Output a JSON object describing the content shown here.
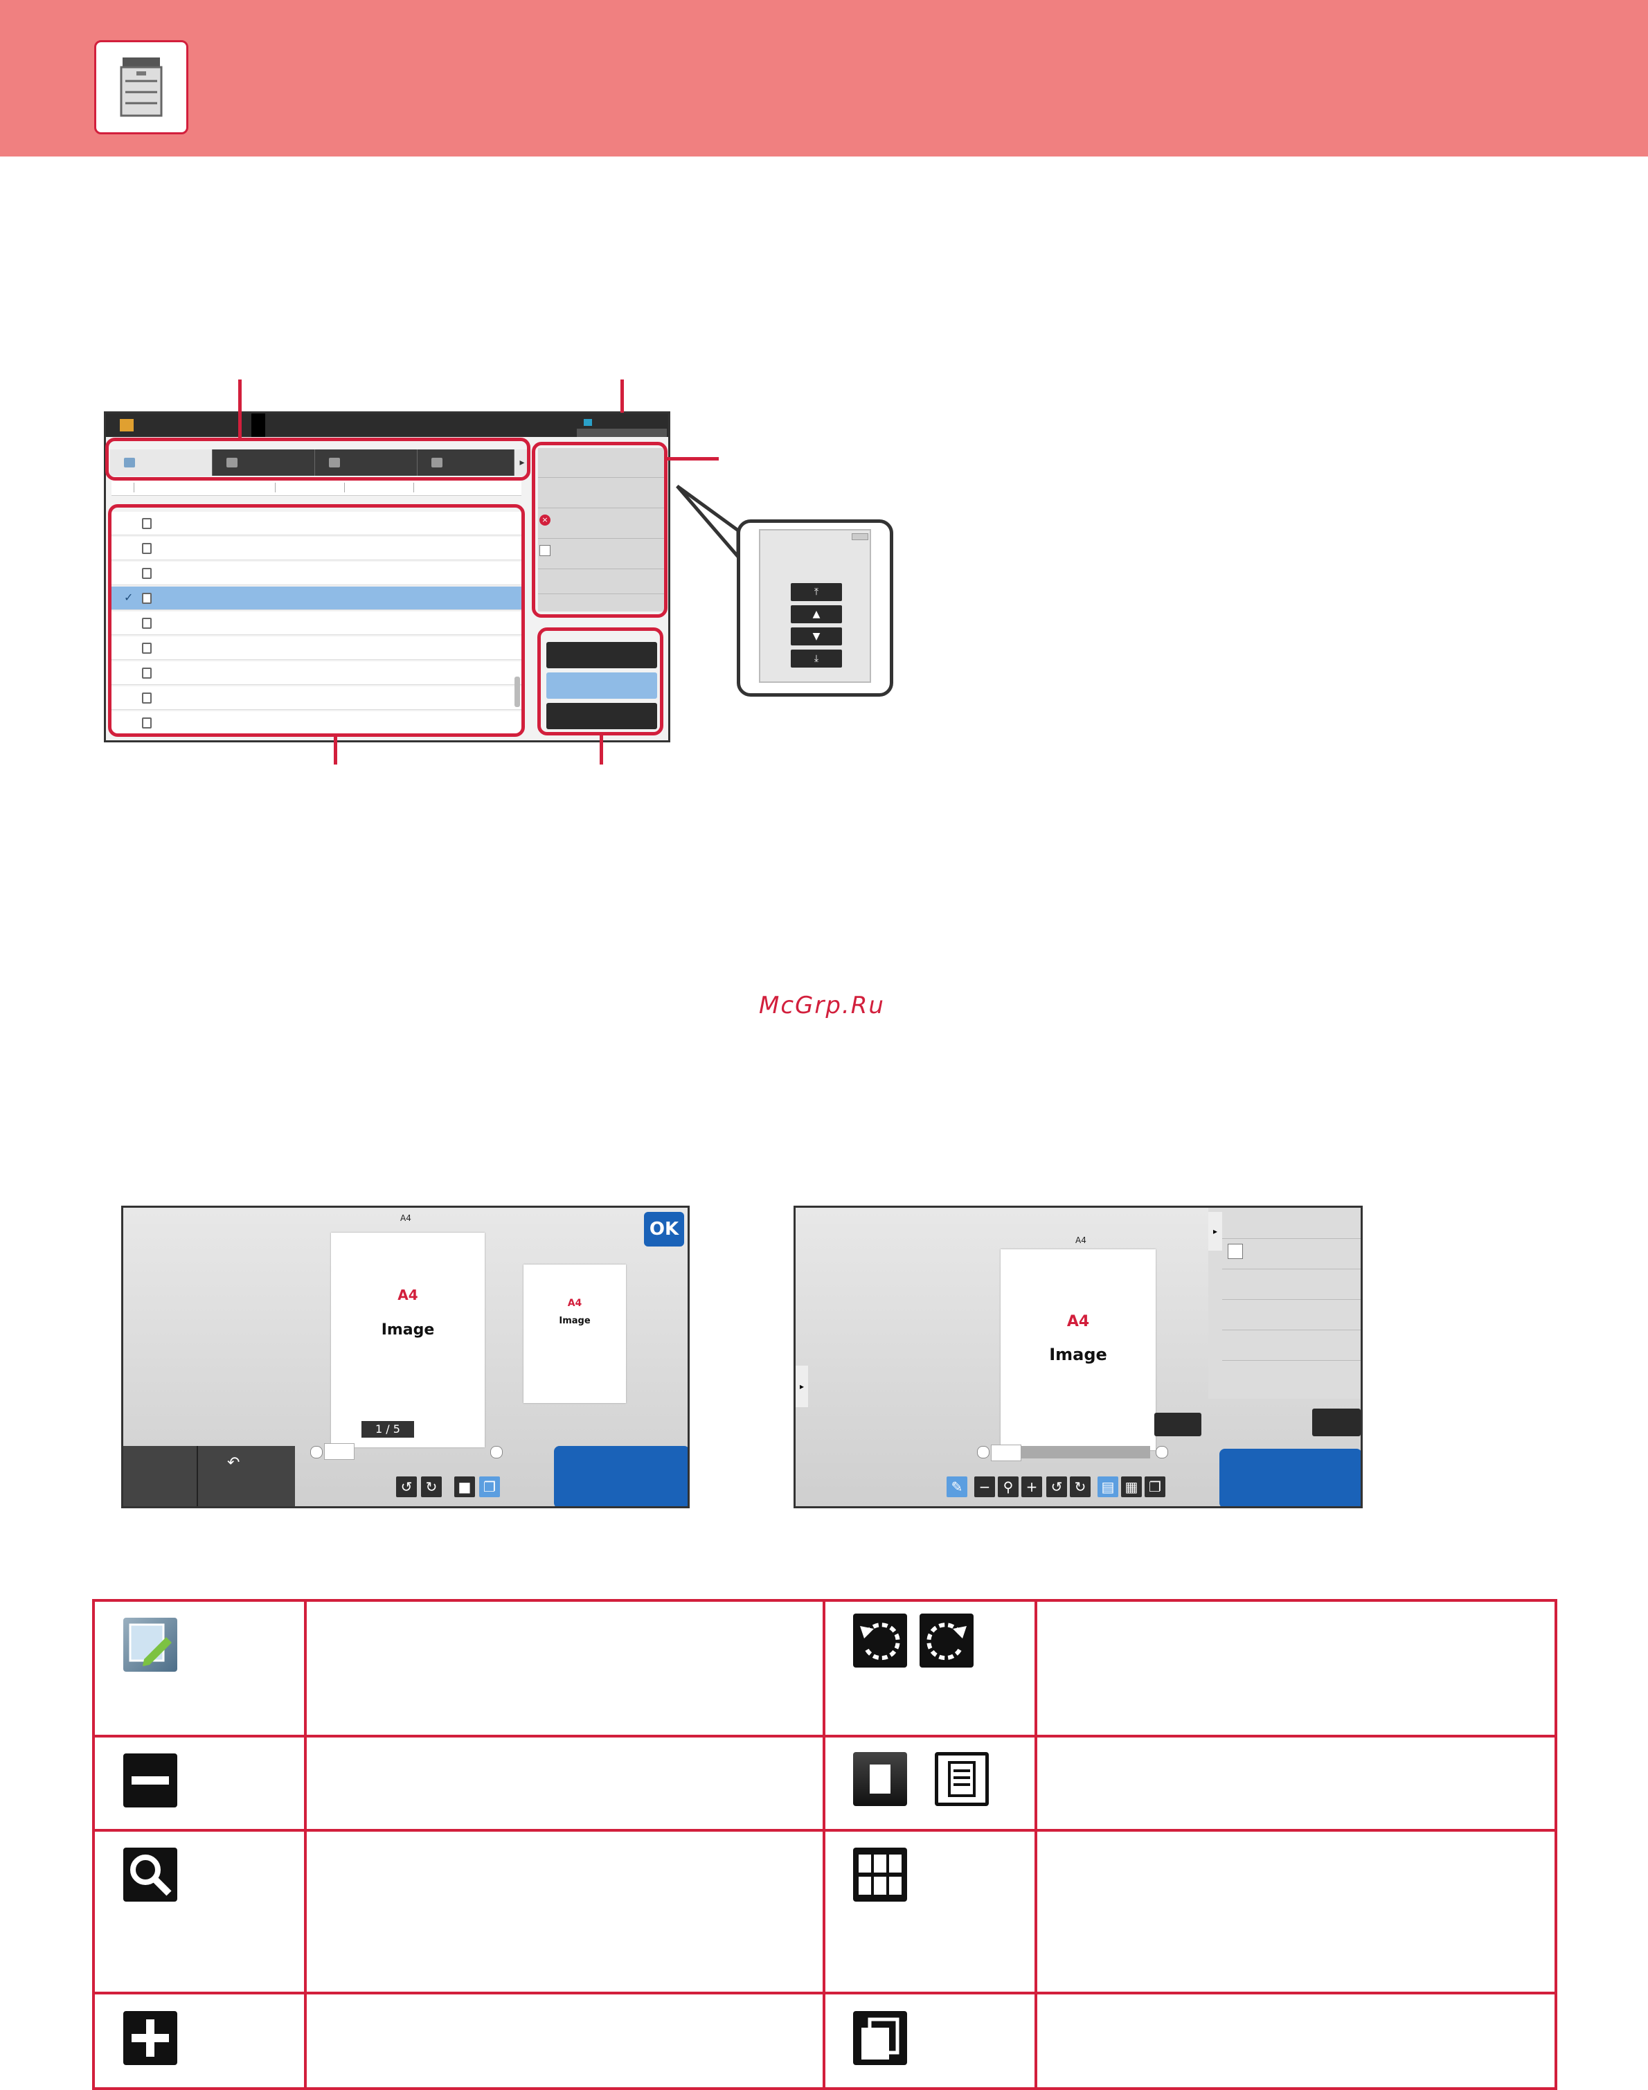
{
  "header": {
    "icon": "printer-icon",
    "bg_color": "#f08080",
    "accent_color": "#d21f3c"
  },
  "watermark": "McGrp.Ru",
  "preview_left": {
    "paper_size": "A4",
    "page_a4": "A4",
    "page_image": "Image",
    "thumb_a4": "A4",
    "thumb_image": "Image",
    "page_counter": "1 / 5",
    "ok_label": "OK"
  },
  "preview_right": {
    "paper_size": "A4",
    "page_a4": "A4",
    "page_image": "Image"
  },
  "icon_table": {
    "rows": [
      {
        "left_icon": "edit-image-icon",
        "right_icon": "rotate-icons"
      },
      {
        "left_icon": "zoom-out-icon",
        "right_icon": "page-view-icons"
      },
      {
        "left_icon": "search-icon",
        "right_icon": "thumbnail-grid-icon"
      },
      {
        "left_icon": "zoom-in-icon",
        "right_icon": "two-page-icon"
      }
    ]
  }
}
